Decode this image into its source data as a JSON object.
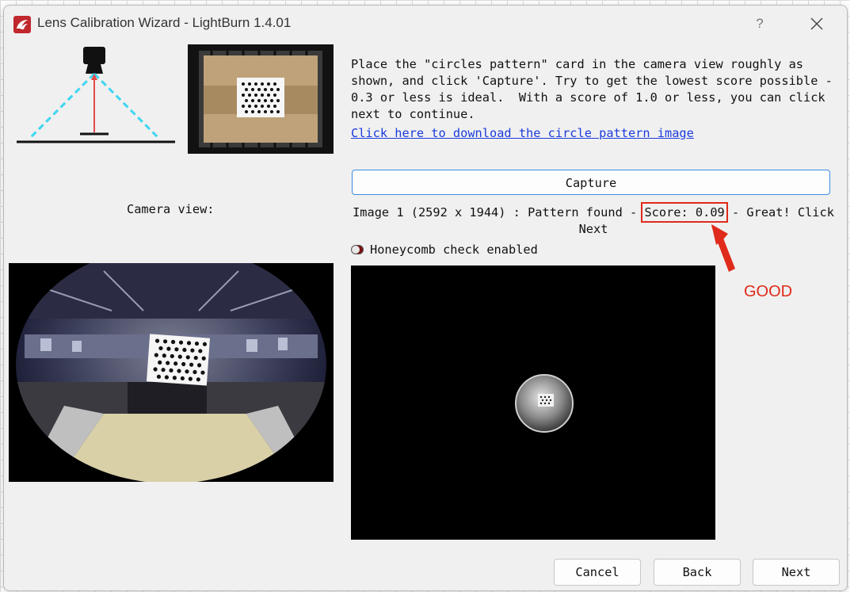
{
  "window": {
    "title": "Lens Calibration Wizard - LightBurn 1.4.01",
    "help_label": "?"
  },
  "instructions": "Place the \"circles pattern\" card in the camera view roughly as\nshown, and click 'Capture'. Try to get the lowest score possible -\n0.3 or less is ideal.  With a score of 1.0 or less, you can click\nnext to continue.",
  "download_link": "Click here to download the circle pattern image",
  "camera_view_label": "Camera view:",
  "capture_label": "Capture",
  "status": {
    "prefix": "Image 1 (2592 x 1944) : Pattern found - ",
    "score": "Score: 0.09",
    "suffix": " - Great! Click",
    "line2": "Next"
  },
  "honeycomb": {
    "label": "Honeycomb check enabled",
    "enabled": true
  },
  "annotation": {
    "label": "GOOD",
    "color": "#e02a1a"
  },
  "buttons": {
    "cancel": "Cancel",
    "back": "Back",
    "next": "Next"
  },
  "colors": {
    "link": "#1b3bdc",
    "focus_border": "#3b8ee0",
    "diagram_beam": "#3fd6f0",
    "diagram_laser": "#e24a4a"
  }
}
